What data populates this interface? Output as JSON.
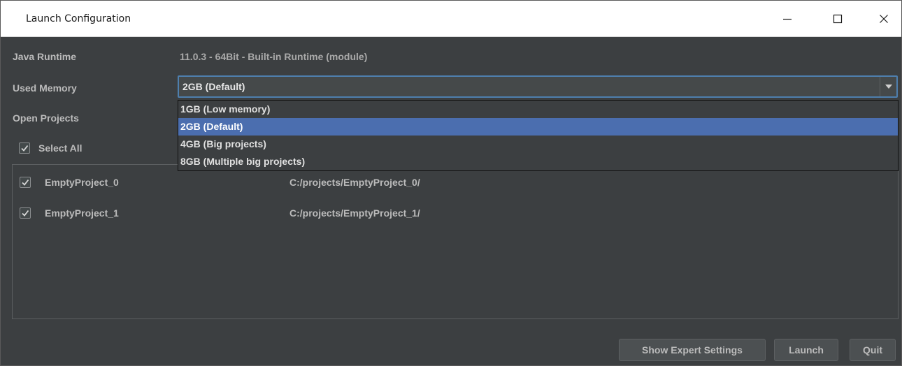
{
  "window": {
    "title": "Launch Configuration",
    "controls": [
      "minimize-icon",
      "maximize-icon",
      "close-icon"
    ]
  },
  "java_runtime": {
    "label": "Java Runtime",
    "value": "11.0.3 - 64Bit - Built-in Runtime (module)"
  },
  "used_memory": {
    "label": "Used Memory",
    "selected": "2GB (Default)",
    "options": [
      {
        "label": "1GB (Low memory)",
        "selected": false
      },
      {
        "label": "2GB (Default)",
        "selected": true
      },
      {
        "label": "4GB (Big projects)",
        "selected": false
      },
      {
        "label": "8GB (Multiple big projects)",
        "selected": false
      }
    ],
    "expanded": true
  },
  "open_projects": {
    "label": "Open Projects",
    "select_all_label": "Select All",
    "select_all_checked": true,
    "projects": [
      {
        "name": "EmptyProject_0",
        "path": "C:/projects/EmptyProject_0/",
        "checked": true
      },
      {
        "name": "EmptyProject_1",
        "path": "C:/projects/EmptyProject_1/",
        "checked": true
      }
    ]
  },
  "buttons": {
    "expert": "Show Expert Settings",
    "launch": "Launch",
    "quit": "Quit"
  },
  "colors": {
    "background": "#3c3f41",
    "accent_border": "#4e7fae",
    "selection": "#4b6eaf",
    "text": "#bbbbbb"
  }
}
